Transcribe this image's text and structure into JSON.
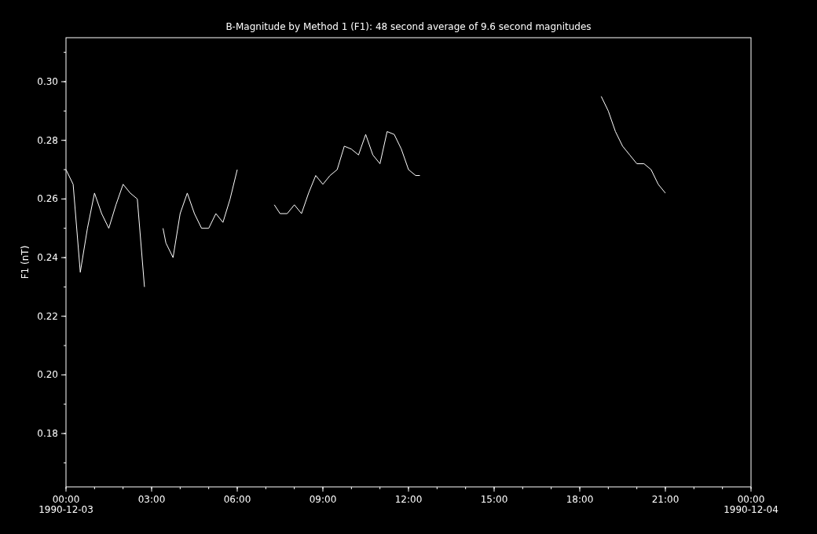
{
  "chart_data": {
    "type": "line",
    "title": "B-Magnitude by Method 1 (F1): 48 second average of 9.6 second magnitudes",
    "ylabel": "F1 (nT)",
    "x": [
      0,
      0.25,
      0.5,
      0.75,
      1,
      1.25,
      1.5,
      1.75,
      2,
      2.25,
      2.5,
      2.75,
      3.4,
      3.5,
      3.75,
      4,
      4.25,
      4.5,
      4.75,
      5,
      5.25,
      5.5,
      5.75,
      6,
      7.3,
      7.5,
      7.75,
      8,
      8.25,
      8.5,
      8.75,
      9,
      9.25,
      9.5,
      9.75,
      10,
      10.25,
      10.5,
      10.75,
      11,
      11.25,
      11.5,
      11.75,
      12,
      12.25,
      12.4,
      18.75,
      19,
      19.25,
      19.5,
      19.75,
      20,
      20.25,
      20.5,
      20.75,
      21
    ],
    "series": [
      {
        "color": "#ffffff",
        "values": [
          0.27,
          0.265,
          0.235,
          0.25,
          0.262,
          0.255,
          0.25,
          0.258,
          0.265,
          0.262,
          0.26,
          0.23,
          0.25,
          0.245,
          0.24,
          0.255,
          0.262,
          0.255,
          0.25,
          0.25,
          0.255,
          0.252,
          0.26,
          0.27,
          0.258,
          0.255,
          0.255,
          0.258,
          0.255,
          0.262,
          0.268,
          0.265,
          0.268,
          0.27,
          0.278,
          0.277,
          0.275,
          0.282,
          0.275,
          0.272,
          0.283,
          0.282,
          0.277,
          0.27,
          0.268,
          0.268,
          0.295,
          0.29,
          0.283,
          0.278,
          0.275,
          0.272,
          0.272,
          0.27,
          0.265,
          0.262
        ]
      }
    ],
    "xlim": [
      0,
      24
    ],
    "ylim": [
      0.1618,
      0.315
    ],
    "xticks": [
      {
        "value": 0,
        "label": "00:00"
      },
      {
        "value": 3,
        "label": "03:00"
      },
      {
        "value": 6,
        "label": "06:00"
      },
      {
        "value": 9,
        "label": "09:00"
      },
      {
        "value": 12,
        "label": "12:00"
      },
      {
        "value": 15,
        "label": "15:00"
      },
      {
        "value": 18,
        "label": "18:00"
      },
      {
        "value": 21,
        "label": "21:00"
      },
      {
        "value": 24,
        "label": "00:00"
      }
    ],
    "yticks": [
      {
        "value": 0.18,
        "label": "0.18"
      },
      {
        "value": 0.2,
        "label": "0.20"
      },
      {
        "value": 0.22,
        "label": "0.22"
      },
      {
        "value": 0.24,
        "label": "0.24"
      },
      {
        "value": 0.26,
        "label": "0.26"
      },
      {
        "value": 0.28,
        "label": "0.28"
      },
      {
        "value": 0.3,
        "label": "0.30"
      }
    ]
  },
  "date_labels": [
    "1990-12-03",
    "1990-12-04"
  ]
}
